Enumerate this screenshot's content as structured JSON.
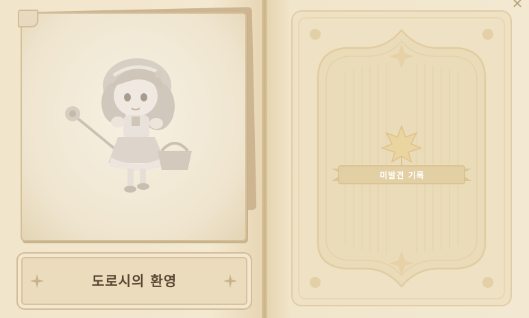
{
  "character": {
    "name": "도로시의 환영",
    "portrait_icon": "character-portrait-icon"
  },
  "locked_card": {
    "label": "미발견 기록",
    "emblem_icon": "maple-leaf-icon"
  },
  "controls": {
    "close_icon": "close-icon",
    "close_glyph": "✕"
  },
  "colors": {
    "page": "#f2e6cd",
    "frame": "#e4d2a8",
    "text": "#5a4633",
    "ribbon": "#e2cfa3"
  }
}
